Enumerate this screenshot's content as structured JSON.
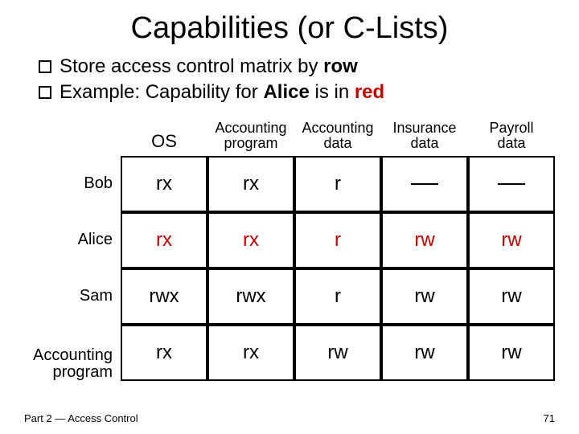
{
  "title": "Capabilities (or C-Lists)",
  "bullets": {
    "b1_pre": "Store access control matrix by ",
    "b1_bold": "row",
    "b2_pre": "Example: Capability for ",
    "b2_bold1": "Alice",
    "b2_mid": " is in ",
    "b2_bold2": "red"
  },
  "columns": {
    "c1": "OS",
    "c2a": "Accounting",
    "c2b": "program",
    "c3a": "Accounting",
    "c3b": "data",
    "c4a": "Insurance",
    "c4b": "data",
    "c5a": "Payroll",
    "c5b": "data"
  },
  "rows": {
    "bob": {
      "label": "Bob",
      "v": [
        "rx",
        "rx",
        "r",
        "---",
        "---"
      ]
    },
    "alice": {
      "label": "Alice",
      "v": [
        "rx",
        "rx",
        "r",
        "rw",
        "rw"
      ]
    },
    "sam": {
      "label": "Sam",
      "v": [
        "rwx",
        "rwx",
        "r",
        "rw",
        "rw"
      ]
    },
    "acct": {
      "label_a": "Accounting",
      "label_b": "program",
      "v": [
        "rx",
        "rx",
        "rw",
        "rw",
        "rw"
      ]
    }
  },
  "footer": {
    "left": "Part 2 — Access Control",
    "right": "71"
  }
}
